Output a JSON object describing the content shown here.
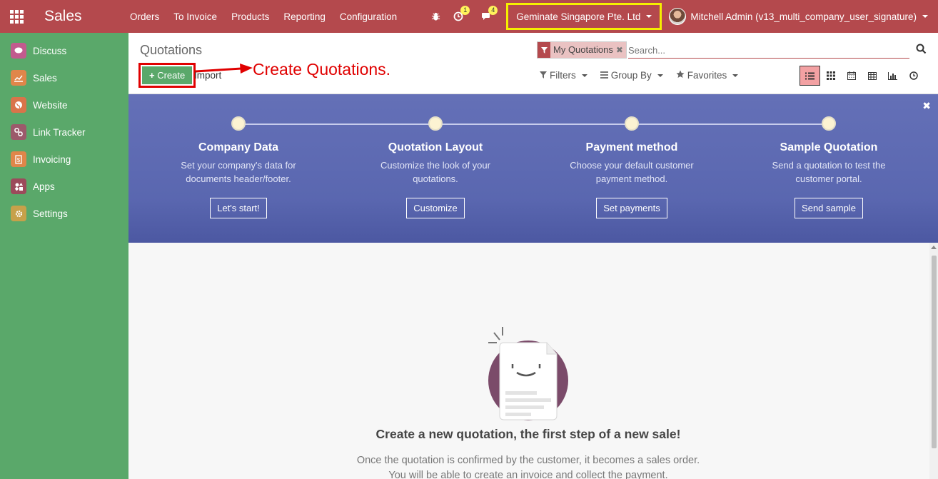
{
  "navbar": {
    "app_title": "Sales",
    "menu": [
      "Orders",
      "To Invoice",
      "Products",
      "Reporting",
      "Configuration"
    ],
    "activity_badge": "1",
    "messages_badge": "4",
    "company": "Geminate Singapore Pte. Ltd",
    "user": "Mitchell Admin (v13_multi_company_user_signature)"
  },
  "sidebar": {
    "items": [
      {
        "label": "Discuss",
        "icon": "discuss-icon",
        "color": "#c25b8e"
      },
      {
        "label": "Sales",
        "icon": "sales-chart-icon",
        "color": "#e0864a"
      },
      {
        "label": "Website",
        "icon": "globe-icon",
        "color": "#d9744a"
      },
      {
        "label": "Link Tracker",
        "icon": "link-icon",
        "color": "#9c5a6b"
      },
      {
        "label": "Invoicing",
        "icon": "invoice-icon",
        "color": "#e0864a"
      },
      {
        "label": "Apps",
        "icon": "apps-icon",
        "color": "#9c4a5b"
      },
      {
        "label": "Settings",
        "icon": "gear-icon",
        "color": "#c7a14a"
      }
    ]
  },
  "control": {
    "breadcrumb": "Quotations",
    "create_label": "Create",
    "import_label": "Import",
    "annotation": "Create Quotations.",
    "facet_label": "My Quotations",
    "search_placeholder": "Search...",
    "filters_label": "Filters",
    "groupby_label": "Group By",
    "favorites_label": "Favorites"
  },
  "banner": {
    "steps": [
      {
        "title": "Company Data",
        "desc1": "Set your company's data for",
        "desc2": "documents header/footer.",
        "button": "Let's start!"
      },
      {
        "title": "Quotation Layout",
        "desc1": "Customize the look of your",
        "desc2": "quotations.",
        "button": "Customize"
      },
      {
        "title": "Payment method",
        "desc1": "Choose your default customer",
        "desc2": "payment method.",
        "button": "Set payments"
      },
      {
        "title": "Sample Quotation",
        "desc1": "Send a quotation to test the",
        "desc2": "customer portal.",
        "button": "Send sample"
      }
    ]
  },
  "empty": {
    "title": "Create a new quotation, the first step of a new sale!",
    "line1": "Once the quotation is confirmed by the customer, it becomes a sales order.",
    "line2": "You will be able to create an invoice and collect the payment."
  },
  "colors": {
    "navbar": "#b4494d",
    "sidebar": "#5aa86a",
    "banner": "#5a67b0",
    "highlight_yellow": "#f5ef00",
    "highlight_red": "#e00000"
  }
}
